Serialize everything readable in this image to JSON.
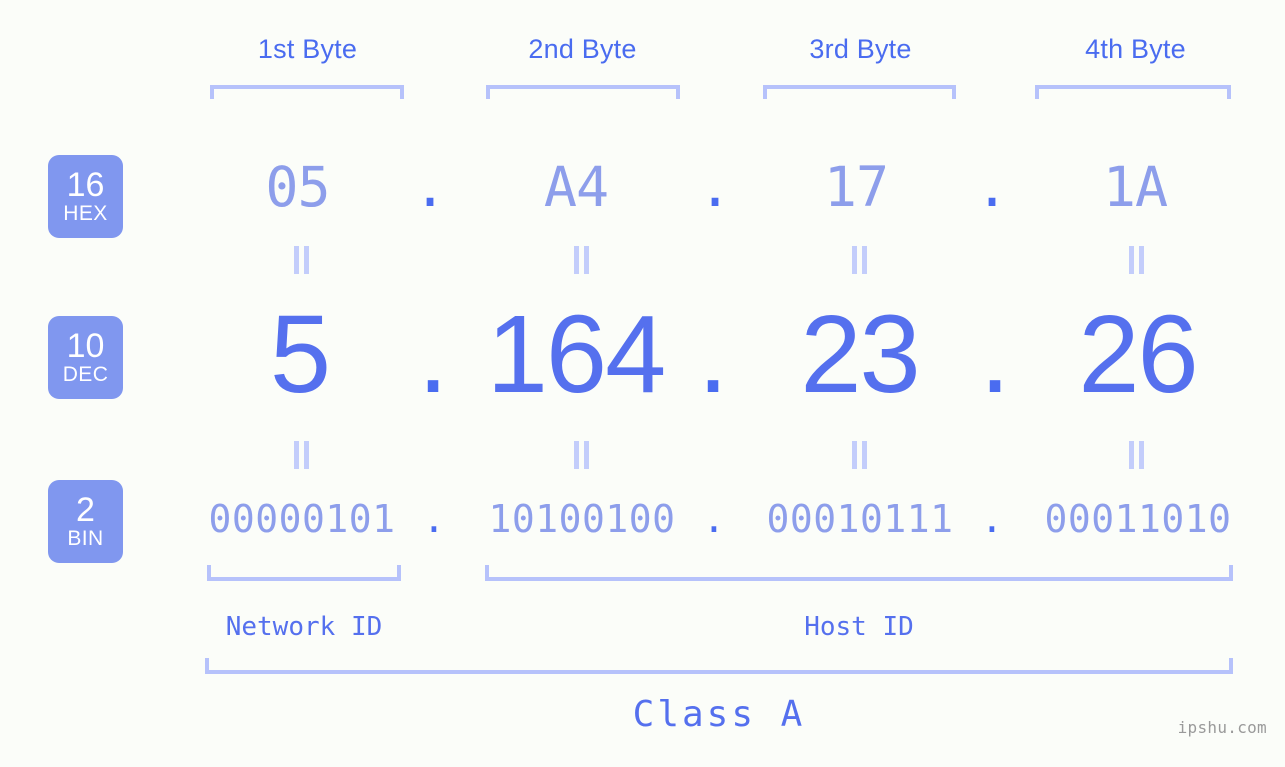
{
  "byte_headers": [
    {
      "label": "1st Byte"
    },
    {
      "label": "2nd Byte"
    },
    {
      "label": "3rd Byte"
    },
    {
      "label": "4th Byte"
    }
  ],
  "rows": {
    "hex": {
      "badge_number": "16",
      "badge_system": "HEX",
      "values": [
        "05",
        "A4",
        "17",
        "1A"
      ],
      "separator": "."
    },
    "dec": {
      "badge_number": "10",
      "badge_system": "DEC",
      "values": [
        "5",
        "164",
        "23",
        "26"
      ],
      "separator": "."
    },
    "bin": {
      "badge_number": "2",
      "badge_system": "BIN",
      "values": [
        "00000101",
        "10100100",
        "00010111",
        "00011010"
      ],
      "separator": "."
    }
  },
  "segments": {
    "network_id": "Network ID",
    "host_id": "Host ID",
    "class": "Class A"
  },
  "watermark": "ipshu.com",
  "colors": {
    "background": "#fbfdf9",
    "accent_strong": "#4a6cf0",
    "accent_dec": "#5570ee",
    "accent_light": "#8d9eeb",
    "badge_fill": "#8097ef",
    "bracket": "#b6c2fb",
    "eq_mark": "#c3cdfb",
    "watermark": "#9a9a9a"
  }
}
